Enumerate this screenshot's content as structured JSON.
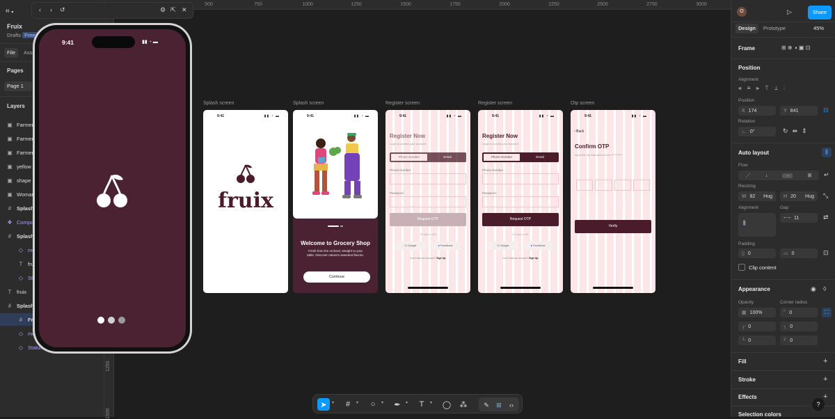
{
  "app": {
    "file_name": "Fruix",
    "drafts_label": "Drafts",
    "plan_badge": "Free",
    "tabs": [
      "File",
      "Assets"
    ],
    "pages_label": "Pages",
    "current_page": "Page 1",
    "layers_label": "Layers"
  },
  "layers": [
    {
      "name": "Farmer",
      "icon": "image-icon",
      "kind": "normal"
    },
    {
      "name": "Farmer",
      "icon": "image-icon",
      "kind": "normal"
    },
    {
      "name": "Farmer",
      "icon": "image-icon",
      "kind": "normal"
    },
    {
      "name": "yellow",
      "icon": "image-icon",
      "kind": "normal"
    },
    {
      "name": "shape",
      "icon": "image-icon",
      "kind": "normal"
    },
    {
      "name": "Woman",
      "icon": "image-icon",
      "kind": "normal"
    },
    {
      "name": "Splash",
      "icon": "frame-icon",
      "kind": "bold"
    },
    {
      "name": "Compo",
      "icon": "component-icon",
      "kind": "purple"
    },
    {
      "name": "Splash",
      "icon": "frame-icon",
      "kind": "bold"
    },
    {
      "name": "mo",
      "icon": "instance-icon",
      "kind": "purple-indent"
    },
    {
      "name": "fru",
      "icon": "text-icon",
      "kind": "indent"
    },
    {
      "name": "Sta",
      "icon": "instance-icon",
      "kind": "purple-indent"
    },
    {
      "name": "fruix",
      "icon": "text-icon",
      "kind": "normal"
    },
    {
      "name": "Splash",
      "icon": "frame-icon",
      "kind": "bold"
    },
    {
      "name": "Fra",
      "icon": "frame-icon",
      "kind": "selected"
    },
    {
      "name": "mo",
      "icon": "instance-icon",
      "kind": "purple-indent"
    },
    {
      "name": "Status",
      "icon": "instance-icon",
      "kind": "purple-indent"
    }
  ],
  "ruler_top": [
    "500",
    "750",
    "1000",
    "1250",
    "1500",
    "1750",
    "2000",
    "2250",
    "2500",
    "2750",
    "3000"
  ],
  "ruler_left": [
    "1250",
    "1500"
  ],
  "frames": [
    {
      "label": "Splash screen",
      "brand": "fruix",
      "time": "9:41"
    },
    {
      "label": "Splash screen",
      "time": "9:41",
      "welcome_title": "Welcome to Grocery Shop",
      "welcome_text": "Fresh from the orchard, straight to your table. Discover nature's sweetest flavors.",
      "cta": "Continue"
    },
    {
      "label": "Register screen",
      "time": "9:41",
      "title": "Register Now",
      "subtitle": "Login to access your account",
      "tab_phone": "Phone Number",
      "tab_email": "Email",
      "field1": "Phone Number",
      "field2": "Password",
      "cta": "Request OTP",
      "or": "Or login in with",
      "google": "Google",
      "facebook": "Facebook",
      "footer": "Don't have an account?",
      "footer_link": "Sign Up"
    },
    {
      "label": "Register screen",
      "time": "9:41",
      "title": "Register Now",
      "subtitle": "Login to access your account",
      "tab_phone": "Phone Number",
      "tab_email": "Email",
      "field1": "Phone Number",
      "field2": "Password",
      "cta": "Request OTP",
      "or": "Or login in with",
      "google": "Google",
      "facebook": "Facebook",
      "footer": "Don't have an account?",
      "footer_link": "Sign Up"
    },
    {
      "label": "Otp screen",
      "time": "9:41",
      "back": "Back",
      "title": "Confirm OTP",
      "subtitle": "Input the otp that was sent to **********",
      "cta": "Verify"
    }
  ],
  "prototype": {
    "time": "9:41"
  },
  "right_panel": {
    "avatar_letter": "O",
    "share": "Share",
    "tab_design": "Design",
    "tab_prototype": "Prototype",
    "zoom": "45%",
    "frame_label": "Frame",
    "position_h": "Position",
    "alignment_l": "Alignment",
    "position_l": "Position",
    "x_label": "X",
    "x_value": "174",
    "y_label": "Y",
    "y_value": "841",
    "rotation_l": "Rotation",
    "rotation_value": "0°",
    "auto_layout_h": "Auto layout",
    "flow_l": "Flow",
    "resizing_l": "Resizing",
    "w_label": "W",
    "w_value": "82",
    "w_mode": "Hug",
    "h_label": "H",
    "h_value": "20",
    "h_mode": "Hug",
    "alignment2_l": "Alignment",
    "gap_l": "Gap",
    "gap_value": "11",
    "padding_l": "Padding",
    "padding_h": "0",
    "padding_v": "0",
    "clip_content": "Clip content",
    "appearance_h": "Appearance",
    "opacity_l": "Opacity",
    "opacity_value": "100%",
    "corner_l": "Corner radius",
    "corner_value": "0",
    "corner_tl": "0",
    "corner_tr": "0",
    "corner_bl": "0",
    "corner_br": "0",
    "fill_h": "Fill",
    "stroke_h": "Stroke",
    "effects_h": "Effects",
    "selection_colors_h": "Selection colors",
    "help": "?"
  },
  "colors": {
    "accent": "#0d99ff",
    "maroon": "#4a1c2b",
    "pink": "#fde6e8",
    "canvas": "#1e1e1e",
    "panel": "#2c2c2c"
  }
}
